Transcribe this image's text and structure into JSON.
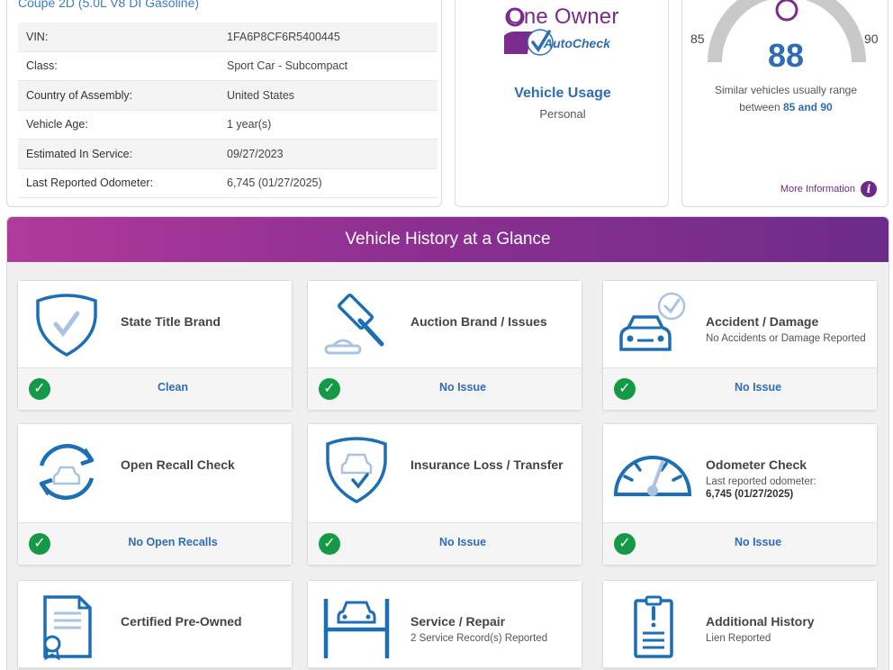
{
  "specs": {
    "title": "Coupe 2D (5.0L V8 DI Gasoline)",
    "rows": [
      {
        "label": "VIN:",
        "value": "1FA6P8CF6R5400445"
      },
      {
        "label": "Class:",
        "value": "Sport Car - Subcompact"
      },
      {
        "label": "Country of Assembly:",
        "value": "United States"
      },
      {
        "label": "Vehicle Age:",
        "value": "1 year(s)"
      },
      {
        "label": "Estimated In Service:",
        "value": "09/27/2023"
      },
      {
        "label": "Last Reported Odometer:",
        "value": "6,745 (01/27/2025)"
      }
    ]
  },
  "owner": {
    "logo_text": "One Owner",
    "brand_text": "AutoCheck",
    "usage_title": "Vehicle Usage",
    "usage_value": "Personal"
  },
  "score": {
    "min": "85",
    "max": "90",
    "value": "88",
    "desc_prefix": "Similar vehicles usually range",
    "desc_between": "between",
    "desc_range": "85 and 90",
    "more_info": "More Information",
    "info_glyph": "i"
  },
  "glance": {
    "title": "Vehicle History at a Glance",
    "cards": [
      {
        "title": "State Title Brand",
        "sub": "",
        "status": "Clean",
        "icon": "shield-check-icon"
      },
      {
        "title": "Auction Brand / Issues",
        "sub": "",
        "status": "No Issue",
        "icon": "gavel-icon"
      },
      {
        "title": "Accident / Damage",
        "sub": "No Accidents or Damage Reported",
        "status": "No Issue",
        "icon": "car-check-icon"
      },
      {
        "title": "Open Recall Check",
        "sub": "",
        "status": "No Open Recalls",
        "icon": "recall-cycle-icon"
      },
      {
        "title": "Insurance Loss / Transfer",
        "sub": "",
        "status": "No Issue",
        "icon": "shield-car-icon"
      },
      {
        "title": "Odometer Check",
        "sub": "Last reported odometer:",
        "sub_bold": "6,745 (01/27/2025)",
        "status": "No Issue",
        "icon": "odometer-icon"
      },
      {
        "title": "Certified Pre-Owned",
        "sub": "",
        "status": "",
        "icon": "certificate-icon"
      },
      {
        "title": "Service / Repair",
        "sub": "2 Service Record(s) Reported",
        "status": "",
        "icon": "car-lift-icon"
      },
      {
        "title": "Additional History",
        "sub": "Lien Reported",
        "status": "",
        "icon": "clipboard-alert-icon"
      }
    ],
    "check_glyph": "✓"
  },
  "colors": {
    "accent_blue": "#2e6db5",
    "purple": "#7b2b8c",
    "success_green": "#149a47",
    "icon_blue": "#1d6fb5"
  }
}
